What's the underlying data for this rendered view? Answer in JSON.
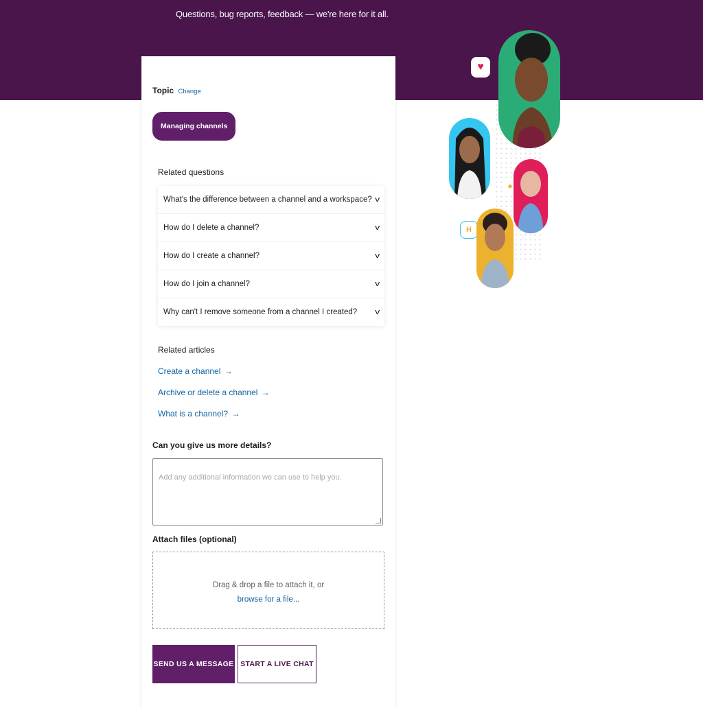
{
  "header": {
    "subtitle": "Questions, bug reports, feedback — we're here for it all."
  },
  "form": {
    "topic_label": "Topic",
    "topic_change": "Change",
    "topic_value": "Managing channels",
    "related_questions_heading": "Related questions",
    "related_questions": [
      "What's the difference between a channel and a workspace?",
      "How do I delete a channel?",
      "How do I create a channel?",
      "How do I join a channel?",
      "Why can't I remove someone from a channel I created?"
    ],
    "related_articles_heading": "Related articles",
    "related_articles": [
      "Create a channel",
      "Archive or delete a channel",
      "What is a channel?"
    ],
    "details_heading": "Can you give us more details?",
    "details_placeholder": "Add any additional information we can use to help you.",
    "attach_heading": "Attach files (optional)",
    "drop_text": "Drag & drop a file to attach it, or",
    "browse_text": "browse for a file...",
    "send_button": "SEND US A MESSAGE",
    "chat_button": "START A LIVE CHAT"
  },
  "illustration": {
    "icons": [
      "heart-icon",
      "wave-icon",
      "hands-icon"
    ],
    "avatar_colors": [
      "#2bac76",
      "#36c5f0",
      "#e01e5a",
      "#ecb22e"
    ]
  }
}
